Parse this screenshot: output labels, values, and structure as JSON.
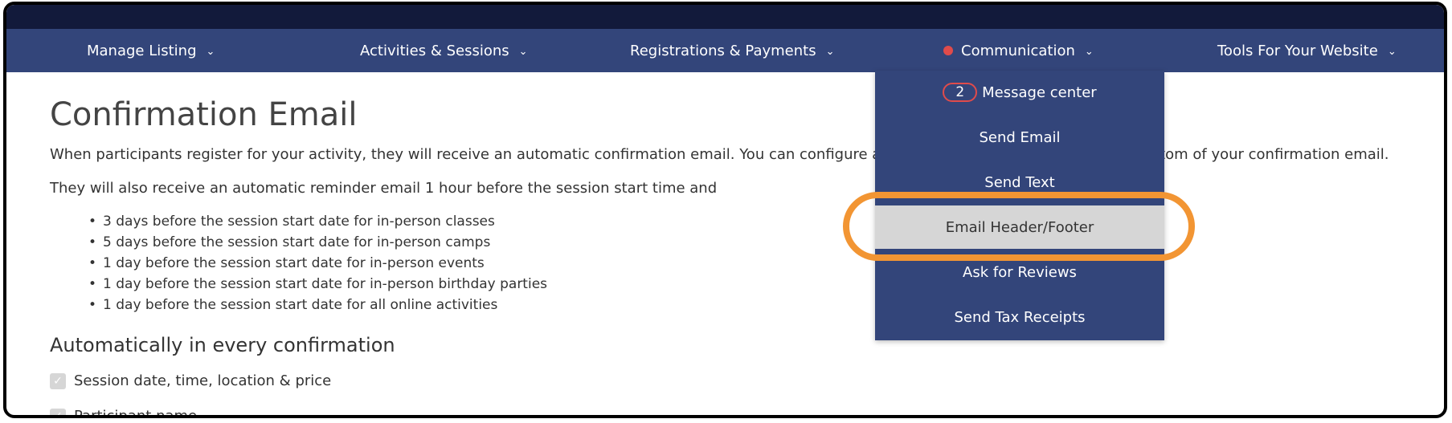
{
  "nav": {
    "items": [
      {
        "label": "Manage Listing"
      },
      {
        "label": "Activities & Sessions"
      },
      {
        "label": "Registrations & Payments"
      },
      {
        "label": "Communication"
      },
      {
        "label": "Tools For Your Website"
      }
    ],
    "chevron_icon": "chevron-down-icon",
    "notification_color": "#e04b4b"
  },
  "page": {
    "title": "Confirmation Email",
    "intro_left": "When participants register for your activity, they will receive an automatic confirmation email. You can configure a",
    "intro_right": "ttom of your confirmation email.",
    "reminder": "They will also receive an automatic reminder email 1 hour before the session start time and",
    "bullets": [
      "3 days before the session start date for in-person classes",
      "5 days before the session start date for in-person camps",
      "1 day before the session start date for in-person events",
      "1 day before the session start date for in-person birthday parties",
      "1 day before the session start date for all online activities"
    ],
    "section_title": "Automatically in every confirmation",
    "checks": [
      {
        "label": "Session date, time, location & price"
      },
      {
        "label": "Participant name"
      }
    ]
  },
  "dropdown": {
    "items": [
      {
        "label": "Message center",
        "badge": "2"
      },
      {
        "label": "Send Email"
      },
      {
        "label": "Send Text"
      },
      {
        "label": "Email Header/Footer"
      },
      {
        "label": "Ask for Reviews"
      },
      {
        "label": "Send Tax Receipts"
      }
    ],
    "highlight_color": "#f29533"
  },
  "colors": {
    "nav_bg": "#33457a",
    "top_strip": "#121a3b",
    "active_item_bg": "#d6d6d6"
  }
}
